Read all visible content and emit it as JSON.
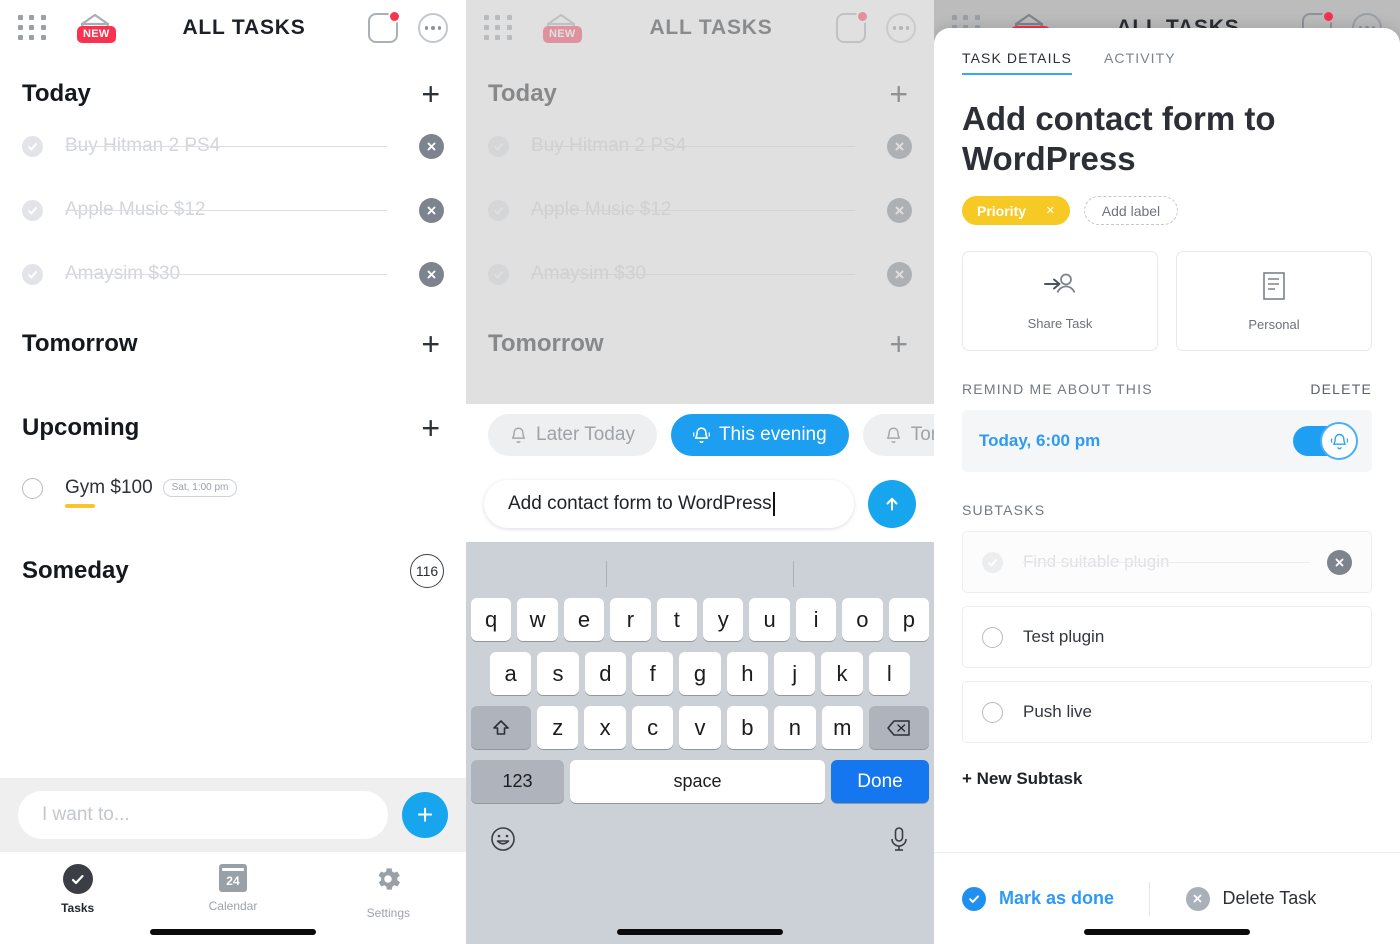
{
  "header": {
    "title": "ALL TASKS",
    "grid_icon": "grid-menu-icon",
    "basket_icon": "basket-icon",
    "new_badge": "NEW",
    "notification_icon": "notification-square-icon",
    "more_icon": "more-options-icon"
  },
  "list": {
    "sections": [
      {
        "title": "Today",
        "action": "+",
        "tasks": [
          {
            "text": "Buy Hitman 2 PS4",
            "done": true
          },
          {
            "text": "Apple Music $12",
            "done": true
          },
          {
            "text": "Amaysim $30",
            "done": true
          }
        ]
      },
      {
        "title": "Tomorrow",
        "action": "+",
        "tasks": []
      },
      {
        "title": "Upcoming",
        "action": "+",
        "tasks": [
          {
            "text": "Gym $100",
            "done": false,
            "date_chip": "Sat, 1:00 pm",
            "priority": true
          }
        ]
      },
      {
        "title": "Someday",
        "count": "116",
        "tasks": []
      }
    ]
  },
  "composer": {
    "placeholder": "I want to...",
    "add_label": "+"
  },
  "tabbar": {
    "items": [
      {
        "label": "Tasks",
        "icon": "check-circle-icon",
        "active": true
      },
      {
        "label": "Calendar",
        "icon": "calendar-icon",
        "day": "24",
        "active": false
      },
      {
        "label": "Settings",
        "icon": "gear-icon",
        "active": false
      }
    ]
  },
  "reminder_chips": [
    {
      "label": "Later Today",
      "active": false
    },
    {
      "label": "This evening",
      "active": true
    },
    {
      "label": "Tomorrow",
      "active": false,
      "truncated": true
    }
  ],
  "task_input": {
    "value": "Add contact form to WordPress",
    "send_icon": "arrow-up-icon"
  },
  "keyboard": {
    "row1": [
      "q",
      "w",
      "e",
      "r",
      "t",
      "y",
      "u",
      "i",
      "o",
      "p"
    ],
    "row2": [
      "a",
      "s",
      "d",
      "f",
      "g",
      "h",
      "j",
      "k",
      "l"
    ],
    "row3": [
      "z",
      "x",
      "c",
      "v",
      "b",
      "n",
      "m"
    ],
    "shift_icon": "shift-icon",
    "backspace_icon": "backspace-icon",
    "numbers_key": "123",
    "space_key": "space",
    "done_key": "Done",
    "emoji_icon": "emoji-icon",
    "mic_icon": "microphone-icon"
  },
  "detail": {
    "tabs": [
      {
        "label": "TASK DETAILS",
        "active": true
      },
      {
        "label": "ACTIVITY",
        "active": false
      }
    ],
    "title": "Add contact form to WordPress",
    "priority_label": "Priority",
    "priority_remove": "×",
    "add_label": "Add label",
    "cards": [
      {
        "label": "Share Task",
        "icon": "share-person-icon"
      },
      {
        "label": "Personal",
        "icon": "document-icon"
      }
    ],
    "remind_section": {
      "title": "REMIND ME ABOUT THIS",
      "action": "DELETE",
      "reminder_text": "Today, 6:00 pm",
      "toggle_on": true,
      "toggle_icon": "bell-icon"
    },
    "subtasks_section": {
      "title": "SUBTASKS",
      "items": [
        {
          "text": "Find suitable plugin",
          "done": true
        },
        {
          "text": "Test plugin",
          "done": false
        },
        {
          "text": "Push live",
          "done": false
        }
      ],
      "new_subtask": "+ New Subtask"
    },
    "footer": {
      "mark_done": "Mark as done",
      "delete_task": "Delete Task"
    }
  },
  "colors": {
    "accent_blue": "#17a6ed",
    "priority_yellow": "#f6c924",
    "badge_red": "#f8324f",
    "done_blue": "#2e9af2"
  }
}
